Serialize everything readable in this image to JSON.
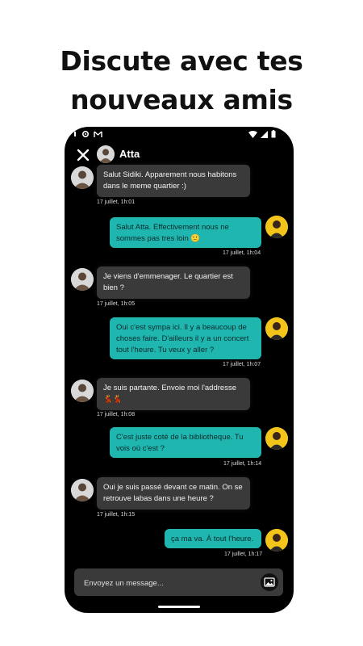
{
  "headline": {
    "line1": "Discute avec tes",
    "line2": "nouveaux amis"
  },
  "status_bar": {
    "left_icons": [
      "gear-icon",
      "gmail-icon"
    ],
    "right_icons": [
      "wifi-icon",
      "signal-icon",
      "battery-icon"
    ]
  },
  "chat": {
    "contact_name": "Atta",
    "messages": [
      {
        "side": "in",
        "text": "Salut Sidiki. Apparement nous habitons dans le meme quartier :)",
        "time": "17 juillet, 1h:01"
      },
      {
        "side": "out",
        "text": "Salut Atta. Effectivement nous ne sommes pas tres loin 🙂",
        "time": "17 juillet, 1h:04"
      },
      {
        "side": "in",
        "text": "Je viens d'emmenager. Le quartier est bien ?",
        "time": "17 juillet, 1h:05"
      },
      {
        "side": "out",
        "text": "Oui c'est sympa ici. Il y a beaucoup de choses  faire. D'ailleurs il y a un concert tout  l'heure. Tu veux y aller ?",
        "time": "17 juillet, 1h:07"
      },
      {
        "side": "in",
        "text": "Je suis partante. Envoie moi l'addresse 💃💃",
        "time": "17 juillet, 1h:08"
      },
      {
        "side": "out",
        "text": "C'est juste  coté de la bibliotheque. Tu vois où c'est ?",
        "time": "17 juillet, 1h:14"
      },
      {
        "side": "in",
        "text": "Oui je suis passé devant ce matin. On se retrouve labas dans une heure ?",
        "time": "17 juillet, 1h:15"
      },
      {
        "side": "out",
        "text": "ça ma va.  À tout  l'heure.",
        "time": "17 juillet, 1h:17"
      }
    ]
  },
  "composer": {
    "placeholder": "Envoyez un message..."
  },
  "colors": {
    "incoming_bubble": "#3a3a3a",
    "outgoing_bubble": "#1fb6b0",
    "background": "#000000",
    "self_avatar_bg": "#f3c51a"
  }
}
